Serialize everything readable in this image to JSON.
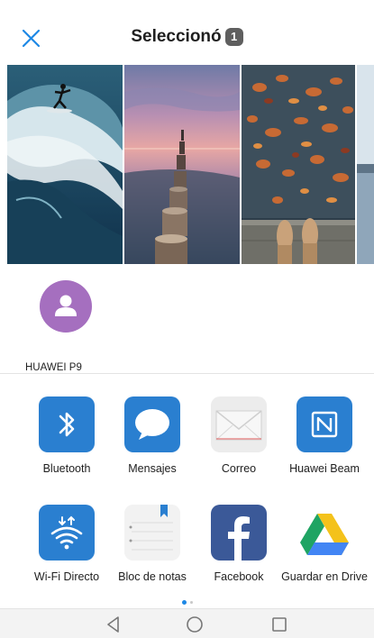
{
  "header": {
    "title": "Seleccionó",
    "selected_count": "1",
    "close_icon": "close-icon"
  },
  "photos": [
    {
      "name": "surfer-wave-photo"
    },
    {
      "name": "pier-posts-sunset-photo"
    },
    {
      "name": "autumn-leaves-puddle-photo"
    },
    {
      "name": "winter-lake-photo"
    }
  ],
  "devices": [
    {
      "label": "HUAWEI P9",
      "icon": "person-icon",
      "color": "#a56fbf"
    }
  ],
  "apps": [
    {
      "label": "Bluetooth",
      "icon": "bluetooth-icon"
    },
    {
      "label": "Mensajes",
      "icon": "message-bubble-icon"
    },
    {
      "label": "Correo",
      "icon": "envelope-icon"
    },
    {
      "label": "Huawei Beam",
      "icon": "nfc-icon"
    },
    {
      "label": "Wi-Fi Directo",
      "icon": "wifi-direct-icon"
    },
    {
      "label": "Bloc de notas",
      "icon": "notepad-icon"
    },
    {
      "label": "Facebook",
      "icon": "facebook-icon"
    },
    {
      "label": "Guardar en Drive",
      "icon": "google-drive-icon"
    }
  ],
  "pager": {
    "current_page": 1,
    "total_pages": 2
  },
  "colors": {
    "accent": "#1e88e5",
    "app_blue": "#2a7fd0",
    "avatar": "#a56fbf",
    "facebook": "#3b5998"
  }
}
